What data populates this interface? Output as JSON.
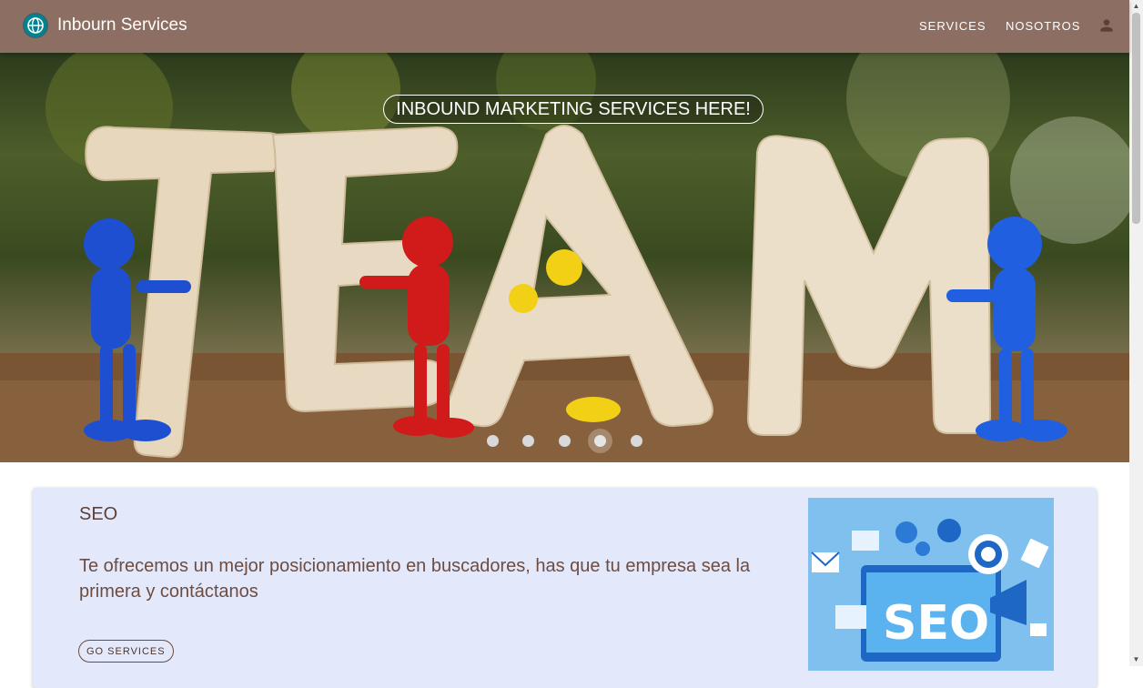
{
  "appbar": {
    "title": "Inbourn Services",
    "nav": [
      "SERVICES",
      "NOSOTROS"
    ],
    "logo_icon": "globe-icon",
    "user_icon": "person-icon",
    "color": "#8d6e63"
  },
  "hero": {
    "title": "INBOUND MARKETING SERVICES HERE!",
    "dots": 5,
    "active_dot": 4
  },
  "card": {
    "title": "SEO",
    "text": "Te ofrecemos un mejor posicionamiento en buscadores, has que tu empresa sea la primera y contáctanos",
    "button": "GO SERVICES",
    "image_text": "SEO",
    "background": "#e3e9fb"
  }
}
